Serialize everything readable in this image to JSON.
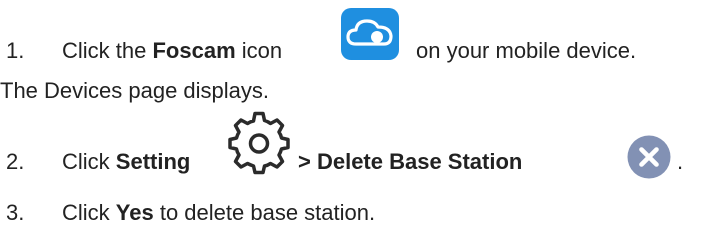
{
  "steps": {
    "step1": {
      "number": "1.",
      "prefix": "Click the ",
      "bold": "Foscam",
      "middle": " icon",
      "suffix": " on your mobile device.",
      "icon": "foscam-cloud-app-icon"
    },
    "note": "The Devices page displays.",
    "step2": {
      "number": "2.",
      "prefix": "Click ",
      "bold1": "Setting",
      "bold2": "> Delete Base Station",
      "suffix": ".",
      "icon1": "gear-icon",
      "icon2": "close-circle-icon"
    },
    "step3": {
      "number": "3.",
      "prefix": "Click ",
      "bold": "Yes",
      "suffix": " to delete base station."
    }
  },
  "colors": {
    "text": "#222222",
    "foscam_icon": "#1f8fe0",
    "close_icon": "#8291b4"
  }
}
